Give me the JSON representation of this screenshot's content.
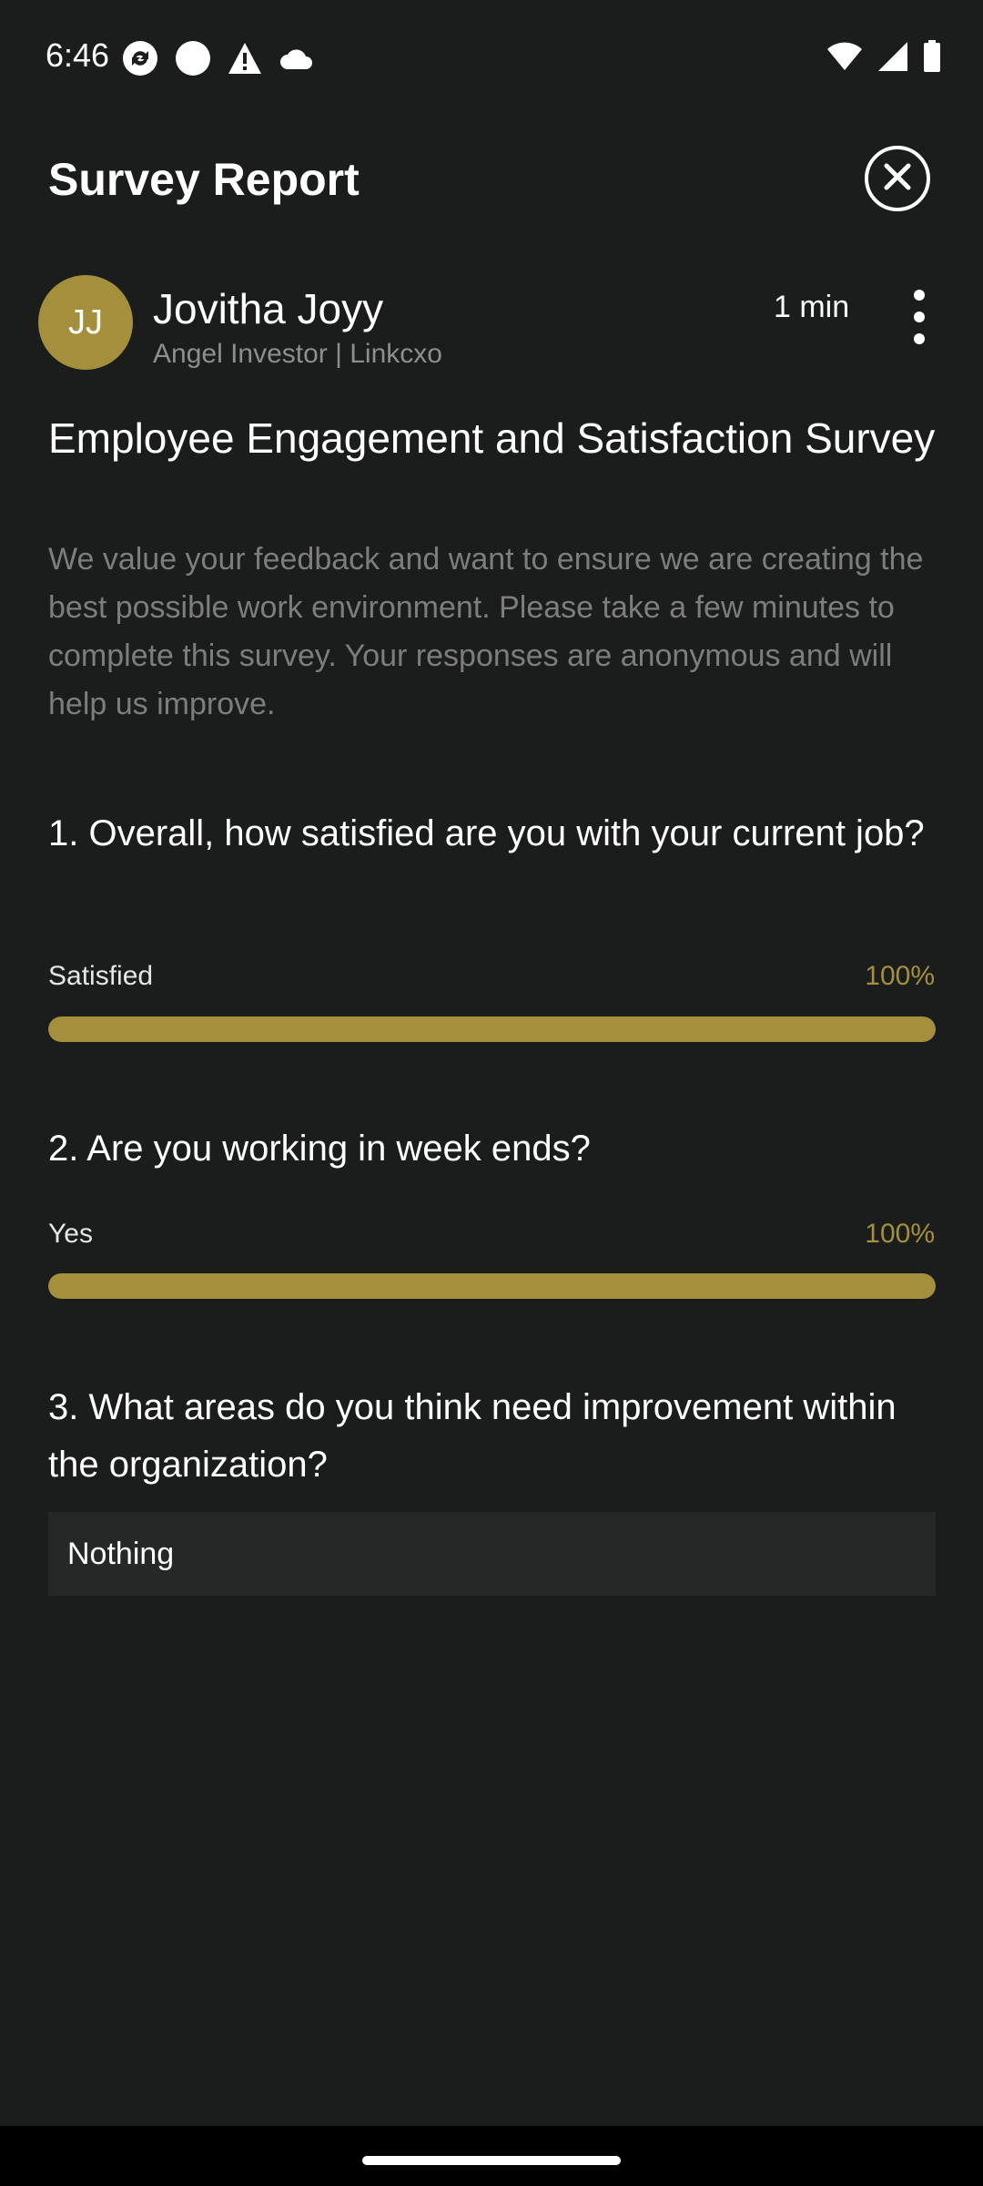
{
  "status_bar": {
    "time": "6:46",
    "left_icons": [
      "sync-icon",
      "circle-icon",
      "warning-icon",
      "cloud-icon"
    ],
    "right_icons": [
      "wifi-icon",
      "signal-icon",
      "battery-icon"
    ]
  },
  "header": {
    "title": "Survey Report"
  },
  "author": {
    "initials": "JJ",
    "name": "Jovitha Joyy",
    "role": "Angel Investor | Linkcxo",
    "time": "1 min"
  },
  "survey": {
    "title": "Employee Engagement and Satisfaction Survey",
    "description": "We value your feedback and want to ensure we are creating the best possible work environment. Please take a few minutes to complete this survey. Your responses are anonymous and will help us improve."
  },
  "questions": [
    {
      "text": "1. Overall, how satisfied are you with your current job?",
      "option": "Satisfied",
      "percent_label": "100%",
      "percent": 100
    },
    {
      "text": "2. Are you working in week ends?",
      "option": "Yes",
      "percent_label": "100%",
      "percent": 100
    },
    {
      "text": "3. What areas do you think need improvement within the organization?",
      "answer": "Nothing"
    }
  ],
  "colors": {
    "background": "#1b1c1c",
    "accent": "#a48f3d",
    "muted_text": "#7d7d7d",
    "answer_box": "#262727"
  }
}
